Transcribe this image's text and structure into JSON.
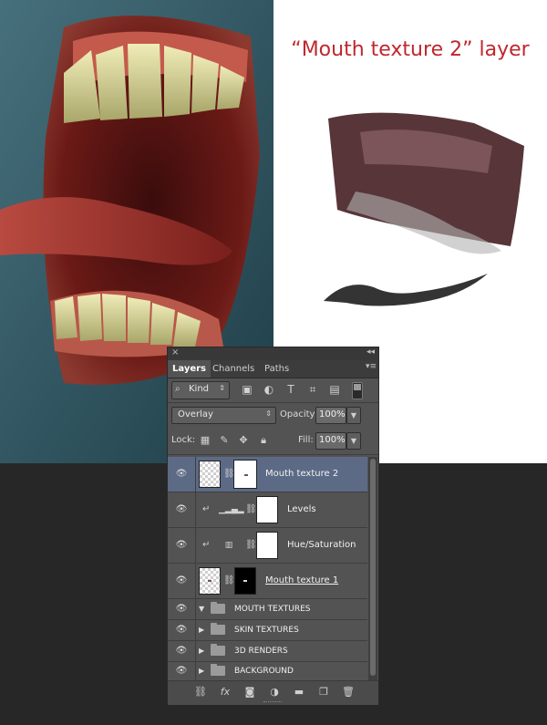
{
  "caption": {
    "title": "“Mouth texture 2” layer"
  },
  "panel": {
    "close_glyph": "×",
    "collapse_glyph": "◂◂",
    "tabs": [
      "Layers",
      "Channels",
      "Paths"
    ],
    "menu_glyph": "▾≡",
    "filter": {
      "kind": "Kind",
      "icons": [
        "image-filter-icon",
        "adjustment-filter-icon",
        "type-filter-icon",
        "shape-filter-icon",
        "smart-object-filter-icon"
      ]
    },
    "blend_mode": "Overlay",
    "opacity_label": "Opacity:",
    "opacity_value": "100%",
    "lock_label": "Lock:",
    "fill_label": "Fill:",
    "fill_value": "100%",
    "layers": [
      {
        "name": "Mouth texture 2",
        "selected": true
      },
      {
        "name": "Levels",
        "adjustment_glyph": "▁▂▄▂"
      },
      {
        "name": "Hue/Saturation",
        "adjustment_glyph": "▥"
      },
      {
        "name": "Mouth texture 1",
        "underlined": true
      },
      {
        "name": "MOUTH TEXTURES",
        "expanded": true
      },
      {
        "name": "SKIN TEXTURES",
        "expanded": false
      },
      {
        "name": "3D RENDERS",
        "expanded": false
      },
      {
        "name": "BACKGROUND",
        "expanded": false
      }
    ],
    "footer_icons": [
      "link-layers-icon",
      "fx-icon",
      "add-mask-icon",
      "new-adjustment-icon",
      "new-group-icon",
      "new-layer-icon",
      "delete-layer-icon"
    ]
  },
  "colors": {
    "caption": "#c0272d",
    "selected_row": "#5c6a86",
    "panel_bg": "#535353"
  }
}
